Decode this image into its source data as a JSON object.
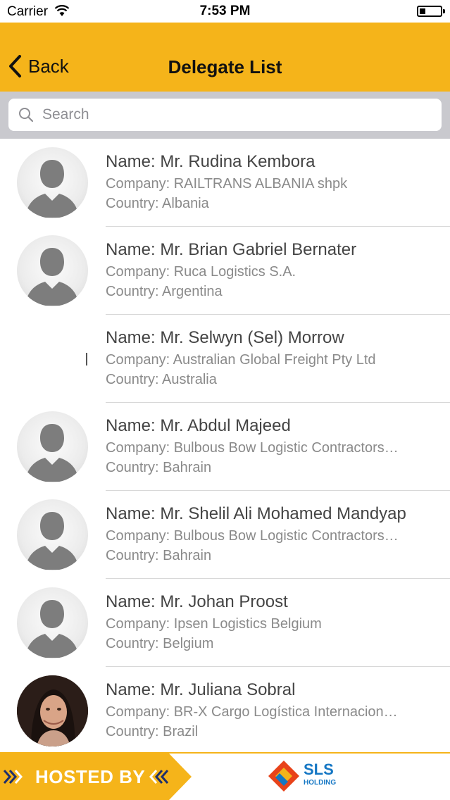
{
  "status_bar": {
    "carrier": "Carrier",
    "time": "7:53 PM"
  },
  "nav": {
    "back_label": "Back",
    "title": "Delegate List"
  },
  "search": {
    "placeholder": "Search",
    "value": ""
  },
  "delegates": [
    {
      "name": "Name: Mr. Rudina Kembora",
      "company": "Company: RAILTRANS ALBANIA shpk",
      "country": "Country: Albania",
      "avatar": "placeholder"
    },
    {
      "name": "Name: Mr. Brian Gabriel Bernater",
      "company": "Company: Ruca Logistics S.A.",
      "country": "Country: Argentina",
      "avatar": "placeholder"
    },
    {
      "name": "Name: Mr. Selwyn (Sel) Morrow",
      "company": "Company: Australian Global Freight Pty Ltd",
      "country": "Country: Australia",
      "avatar": "empty"
    },
    {
      "name": "Name: Mr. Abdul Majeed",
      "company": "Company: Bulbous Bow Logistic Contractors…",
      "country": "Country: Bahrain",
      "avatar": "placeholder"
    },
    {
      "name": "Name: Mr. Shelil Ali Mohamed Mandyap",
      "company": "Company: Bulbous Bow Logistic Contractors…",
      "country": "Country: Bahrain",
      "avatar": "placeholder"
    },
    {
      "name": "Name: Mr. Johan Proost",
      "company": "Company: Ipsen Logistics Belgium",
      "country": "Country: Belgium",
      "avatar": "placeholder"
    },
    {
      "name": "Name: Mr. Juliana Sobral",
      "company": "Company: BR-X Cargo Logística Internacion…",
      "country": "Country: Brazil",
      "avatar": "photo"
    }
  ],
  "footer": {
    "hosted_label": "HOSTED BY",
    "sponsor_name": "SLS",
    "sponsor_sub": "HOLDING",
    "colors": {
      "banner": "#f5b41a",
      "sponsor_blue": "#1577c4"
    }
  },
  "colors": {
    "nav_background": "#f5b41a",
    "search_background": "#c9c9ce"
  }
}
